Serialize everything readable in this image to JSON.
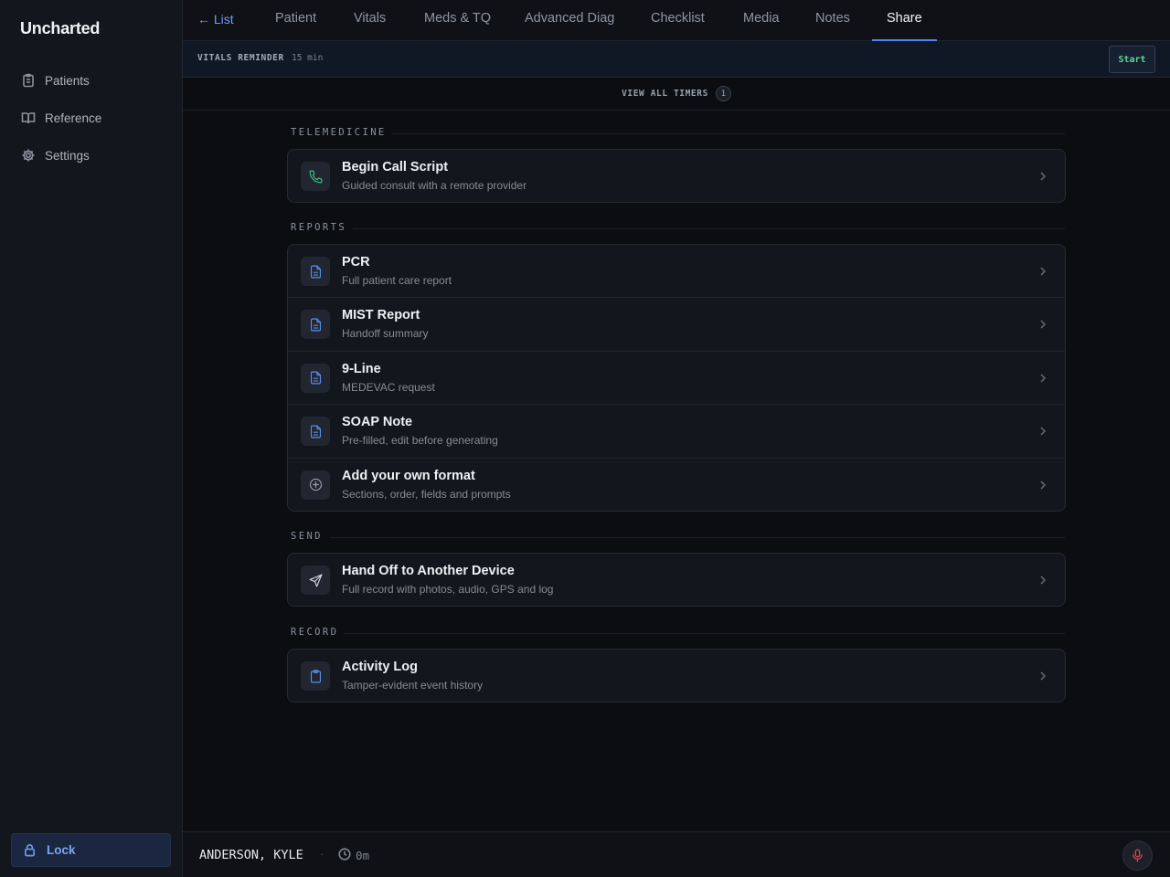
{
  "app": {
    "name": "Uncharted"
  },
  "sidebar": {
    "items": [
      {
        "label": "Patients",
        "icon": "clipboard-list-icon"
      },
      {
        "label": "Reference",
        "icon": "book-open-icon"
      },
      {
        "label": "Settings",
        "icon": "gear-icon"
      }
    ],
    "lock_label": "Lock"
  },
  "topnav": {
    "back_label": "← List",
    "tabs": [
      {
        "label": "Patient"
      },
      {
        "label": "Vitals"
      },
      {
        "label": "Meds & TQ"
      },
      {
        "label": "Advanced Diag"
      },
      {
        "label": "Checklist"
      },
      {
        "label": "Media"
      },
      {
        "label": "Notes"
      },
      {
        "label": "Share",
        "active": true
      }
    ]
  },
  "timer": {
    "label": "VITALS REMINDER",
    "value": "15 min",
    "start_label": "Start",
    "view_all_label": "VIEW ALL TIMERS",
    "count": "1"
  },
  "sections": {
    "telemedicine": {
      "label": "TELEMEDICINE",
      "items": [
        {
          "title": "Begin Call Script",
          "subtitle": "Guided consult with a remote provider",
          "icon": "phone-icon"
        }
      ]
    },
    "reports": {
      "label": "REPORTS",
      "items": [
        {
          "title": "PCR",
          "subtitle": "Full patient care report",
          "icon": "document-icon"
        },
        {
          "title": "MIST Report",
          "subtitle": "Handoff summary",
          "icon": "document-icon"
        },
        {
          "title": "9-Line",
          "subtitle": "MEDEVAC request",
          "icon": "document-icon"
        },
        {
          "title": "SOAP Note",
          "subtitle": "Pre-filled, edit before generating",
          "icon": "document-icon"
        },
        {
          "title": "Add your own format",
          "subtitle": "Sections, order, fields and prompts",
          "icon": "plus-circle-icon"
        }
      ]
    },
    "send": {
      "label": "SEND",
      "items": [
        {
          "title": "Hand Off to Another Device",
          "subtitle": "Full record with photos, audio, GPS and log",
          "icon": "send-icon"
        }
      ]
    },
    "record": {
      "label": "RECORD",
      "items": [
        {
          "title": "Activity Log",
          "subtitle": "Tamper-evident event history",
          "icon": "clipboard-icon"
        }
      ]
    }
  },
  "footer": {
    "patient_name": "ANDERSON, KYLE",
    "separator": "·",
    "elapsed": "0m"
  },
  "colors": {
    "accent": "#4f86ee",
    "phone_icon": "#3fbf86",
    "start_text": "#63d39a",
    "mic": "#e0484d"
  }
}
